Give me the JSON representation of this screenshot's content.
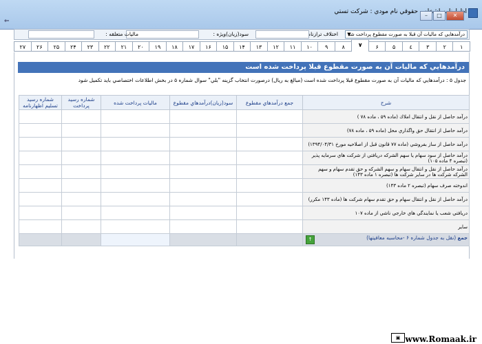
{
  "window": {
    "title": "اظهارنامه اشخاص حقوقي   نام مودي : شركت تستي",
    "left_glyph": "⇐",
    "buttons": [
      "–",
      "□",
      "✕"
    ]
  },
  "infobar": {
    "combo_value": "درآمدهايي كه ماليات آن قبلا به صورت مقطوع پرداخت شد",
    "combo_arrow": "▼",
    "ekhtelaf_label": "اختلاف ترازنامه :",
    "sood_label": "سود(زيان)ويژه :",
    "maliat_label": "ماليات متعلقه :"
  },
  "tabs": [
    "1",
    "2",
    "3",
    "4",
    "5",
    "6",
    "7",
    "8",
    "9",
    "10",
    "11",
    "12",
    "13",
    "14",
    "15",
    "16",
    "17",
    "18",
    "19",
    "20",
    "21",
    "22",
    "23",
    "24",
    "25",
    "26",
    "27"
  ],
  "tabs_display": [
    "١",
    "٢",
    "٣",
    "٤",
    "۵",
    "۶",
    "٧",
    "٨",
    "٩",
    "١٠",
    "١١",
    "١٢",
    "١٣",
    "١۴",
    "١۵",
    "١۶",
    "١٧",
    "١٨",
    "١٩",
    "٢٠",
    "٢١",
    "٢٢",
    "٢٣",
    "٢۴",
    "٢۵",
    "٢۶",
    "٢٧"
  ],
  "active_tab": "٧",
  "section": {
    "header": "درآمدهايي كه ماليات آن به صورت مقطوع قبلا پرداخت شده است",
    "note": "جدول ۵ : درآمدهايي كه ماليات آن به صورت مقطوع قبلا پرداخت شده است (مبالغ به ريال) درصورت انتخاب گزينه \"بلي\" سوال شماره ۵ در بخش اطلاعات اختصاصي بايد تكميل شود"
  },
  "table": {
    "columns": [
      "شرح",
      "جمع درآمدهاي مقطوع",
      "سود(زيان)درآمدهاي مقطوع",
      "ماليات پرداخت شده",
      "شماره رسيد پرداخت",
      "شماره رسيد تسليم اظهارنامه"
    ],
    "rows": [
      "درآمد حاصل از نقل و انتقال املاك (ماده ۵۹ ، ماده ۷۸ )",
      "درآمد حاصل از انتقال حق واگذاري محل (ماده ۵۹ ، ماده ۷۸)",
      "درآمد حاصل از ساز بفروشي (ماده ۷۷ قانون قبل از اصلاحيه مورخ ۱۳۹۴/۰۴/۳۱)",
      "درآمد حاصل از سود سهام يا سهم الشركه دريافتي از شركت هاي سرمايه پذير (تبصره ۴ ماده ۱۰۵)",
      "درآمد حاصل از نقل و انتقال سهام و سهم الشركه و حق تقدم سهام و سهم الشركه شركت ها در ساير شركت ها (تبصره ۱ ماده ۱۴۳)",
      "اندوخته صرف سهام (تبصره ۲ ماده ۱۴۳)",
      "درآمد حاصل از نقل و انتقال سهام و حق تقدم سهام شركت ها (ماده ۱۴۳ مكرر)",
      "دريافتي شعب يا نمايندگي هاي خارجي ناشي از ماده ۱۰۷",
      "ساير"
    ],
    "total_label": "جمع",
    "total_note": "(نقل به جدول شماره ۶ -محاسبه معافيتها)",
    "go_icon": "↑"
  },
  "footer": {
    "brand": "www.Romaak.ir"
  }
}
